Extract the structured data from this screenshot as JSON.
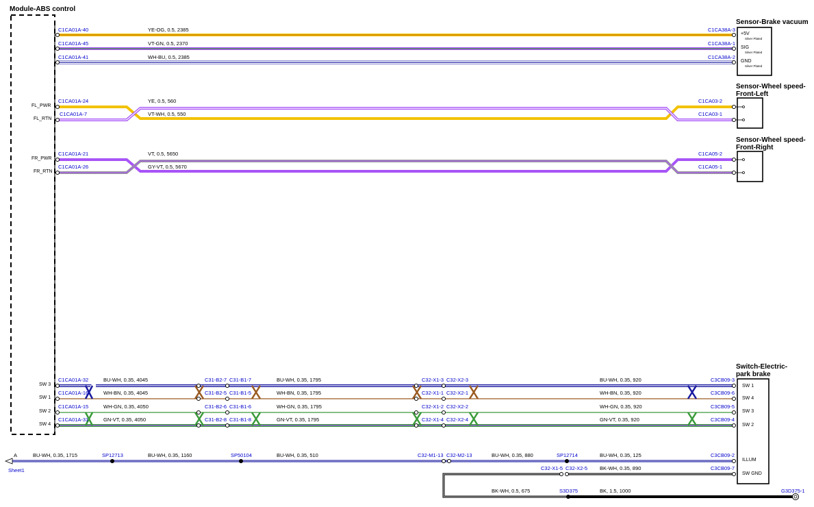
{
  "colors": {
    "YE": "#f2c200",
    "OG": "#c97800",
    "VT": "#a855f7",
    "GN": "#3a9a3a",
    "WH": "#ffffff",
    "BU": "#1a1aa0",
    "GY": "#9a9a9a",
    "BN": "#9a5a20",
    "BK": "#000000",
    "label_blue": "#0000cc"
  },
  "modules": {
    "abs": {
      "title": "Module-ABS control"
    },
    "vacuum": {
      "title": "Sensor-Brake vacuum",
      "pins": [
        {
          "label": "+5V",
          "note": "Silver Plated"
        },
        {
          "label": "SIG",
          "note": "Silver Plated"
        },
        {
          "label": "GND",
          "note": "Silver Plated"
        }
      ]
    },
    "wheel_left": {
      "title_1": "Sensor-Wheel speed-",
      "title_2": "Front-Left"
    },
    "wheel_right": {
      "title_1": "Sensor-Wheel speed-",
      "title_2": "Front-Right"
    },
    "park": {
      "title_1": "Switch-Electric-",
      "title_2": "park brake",
      "pins": [
        "SW 1",
        "SW 4",
        "SW 3",
        "SW 2",
        "ILLUM",
        "SW GND"
      ]
    }
  },
  "abs_pin_labels": [
    {
      "id": "fl_pwr",
      "text": "FL_PWR"
    },
    {
      "id": "fl_rtn",
      "text": "FL_RTN"
    },
    {
      "id": "fr_pwr",
      "text": "FR_PWR"
    },
    {
      "id": "fr_rtn",
      "text": "FR_RTN"
    },
    {
      "id": "sw3",
      "text": "SW 3"
    },
    {
      "id": "sw1",
      "text": "SW 1"
    },
    {
      "id": "sw2",
      "text": "SW 2"
    },
    {
      "id": "sw4",
      "text": "SW 4"
    }
  ],
  "wires": [
    {
      "from": "C1CA01A-40",
      "spec": "YE-OG,  0.5,  2385",
      "to": "C1CA38A-3",
      "base": "YE",
      "stripe": "OG"
    },
    {
      "from": "C1CA01A-45",
      "spec": "VT-GN,  0.5,  2370",
      "to": "C1CA38A-1",
      "base": "VT",
      "stripe": "GN"
    },
    {
      "from": "C1CA01A-41",
      "spec": "WH-BU,  0.5,  2385",
      "to": "C1CA38A-2",
      "base": "WH",
      "stripe": "BU"
    },
    {
      "from": "C1CA01A-24",
      "spec": "YE,  0.5,  560",
      "to": "C1CA03-2",
      "base": "YE"
    },
    {
      "from": "C1CA01A-7",
      "spec": "VT-WH,  0.5,  550",
      "to": "C1CA03-1",
      "base": "VT",
      "stripe": "WH"
    },
    {
      "from": "C1CA01A-21",
      "spec": "VT,  0.5,  5650",
      "to": "C1CA05-2",
      "base": "VT"
    },
    {
      "from": "C1CA01A-26",
      "spec": "GY-VT,  0.5,  5670",
      "to": "C1CA05-1",
      "base": "GY",
      "stripe": "VT"
    }
  ],
  "sw_wires": [
    {
      "from": "C1CA01A-32",
      "s1": "BU-WH,  0.35,  4045",
      "c1a": "C31-B2-7",
      "c1b": "C31-B1-7",
      "s2": "BU-WH,  0.35,  1795",
      "c2a": "C32-X1-3",
      "c2b": "C32-X2-3",
      "s3": "BU-WH,  0.35,  920",
      "to": "C3CB09-3"
    },
    {
      "from": "C1CA01A-16",
      "s1": "WH-BN,  0.35,  4045",
      "c1a": "C31-B2-5",
      "c1b": "C31-B1-5",
      "s2": "WH-BN,  0.35,  1795",
      "c2a": "C32-X1-1",
      "c2b": "C32-X2-1",
      "s3": "WH-BN,  0.35,  920",
      "to": "C3CB09-6"
    },
    {
      "from": "C1CA01A-15",
      "s1": "WH-GN,  0.35,  4050",
      "c1a": "C31-B2-6",
      "c1b": "C31-B1-6",
      "s2": "WH-GN,  0.35,  1795",
      "c2a": "C32-X1-2",
      "c2b": "C32-X2-2",
      "s3": "WH-GN,  0.35,  920",
      "to": "C3CB09-5"
    },
    {
      "from": "C1CA01A-31",
      "s1": "GN-VT,  0.35,  4050",
      "c1a": "C31-B2-8",
      "c1b": "C31-B1-8",
      "s2": "GN-VT,  0.35,  1795",
      "c2a": "C32-X1-4",
      "c2b": "C32-X2-4",
      "s3": "GN-VT,  0.35,  920",
      "to": "C3CB09-4"
    }
  ],
  "illum": {
    "ref": "A",
    "sheet": "Sheet1",
    "s1": "BU-WH,  0.35,  1715",
    "sp1": "SP12713",
    "s2": "BU-WH,  0.35,  1160",
    "sp2": "SP50104",
    "s3": "BU-WH,  0.35,  510",
    "c1": "C32-M1-13",
    "c2": "C32-M2-13",
    "s4": "BU-WH,  0.35,  880",
    "sp3": "SP12714",
    "s5": "BU-WH,  0.35,  125",
    "to": "C3CB09-2"
  },
  "gnd": {
    "c1": "C32-X1-5",
    "c2": "C32-X2-5",
    "s1": "BK-WH,  0.35,  890",
    "to": "C3CB09-7",
    "s2": "BK-WH,  0.5,  675",
    "splice": "S3D375",
    "s3": "BK,  1.5,  1000",
    "ground": "G3D375-1"
  }
}
